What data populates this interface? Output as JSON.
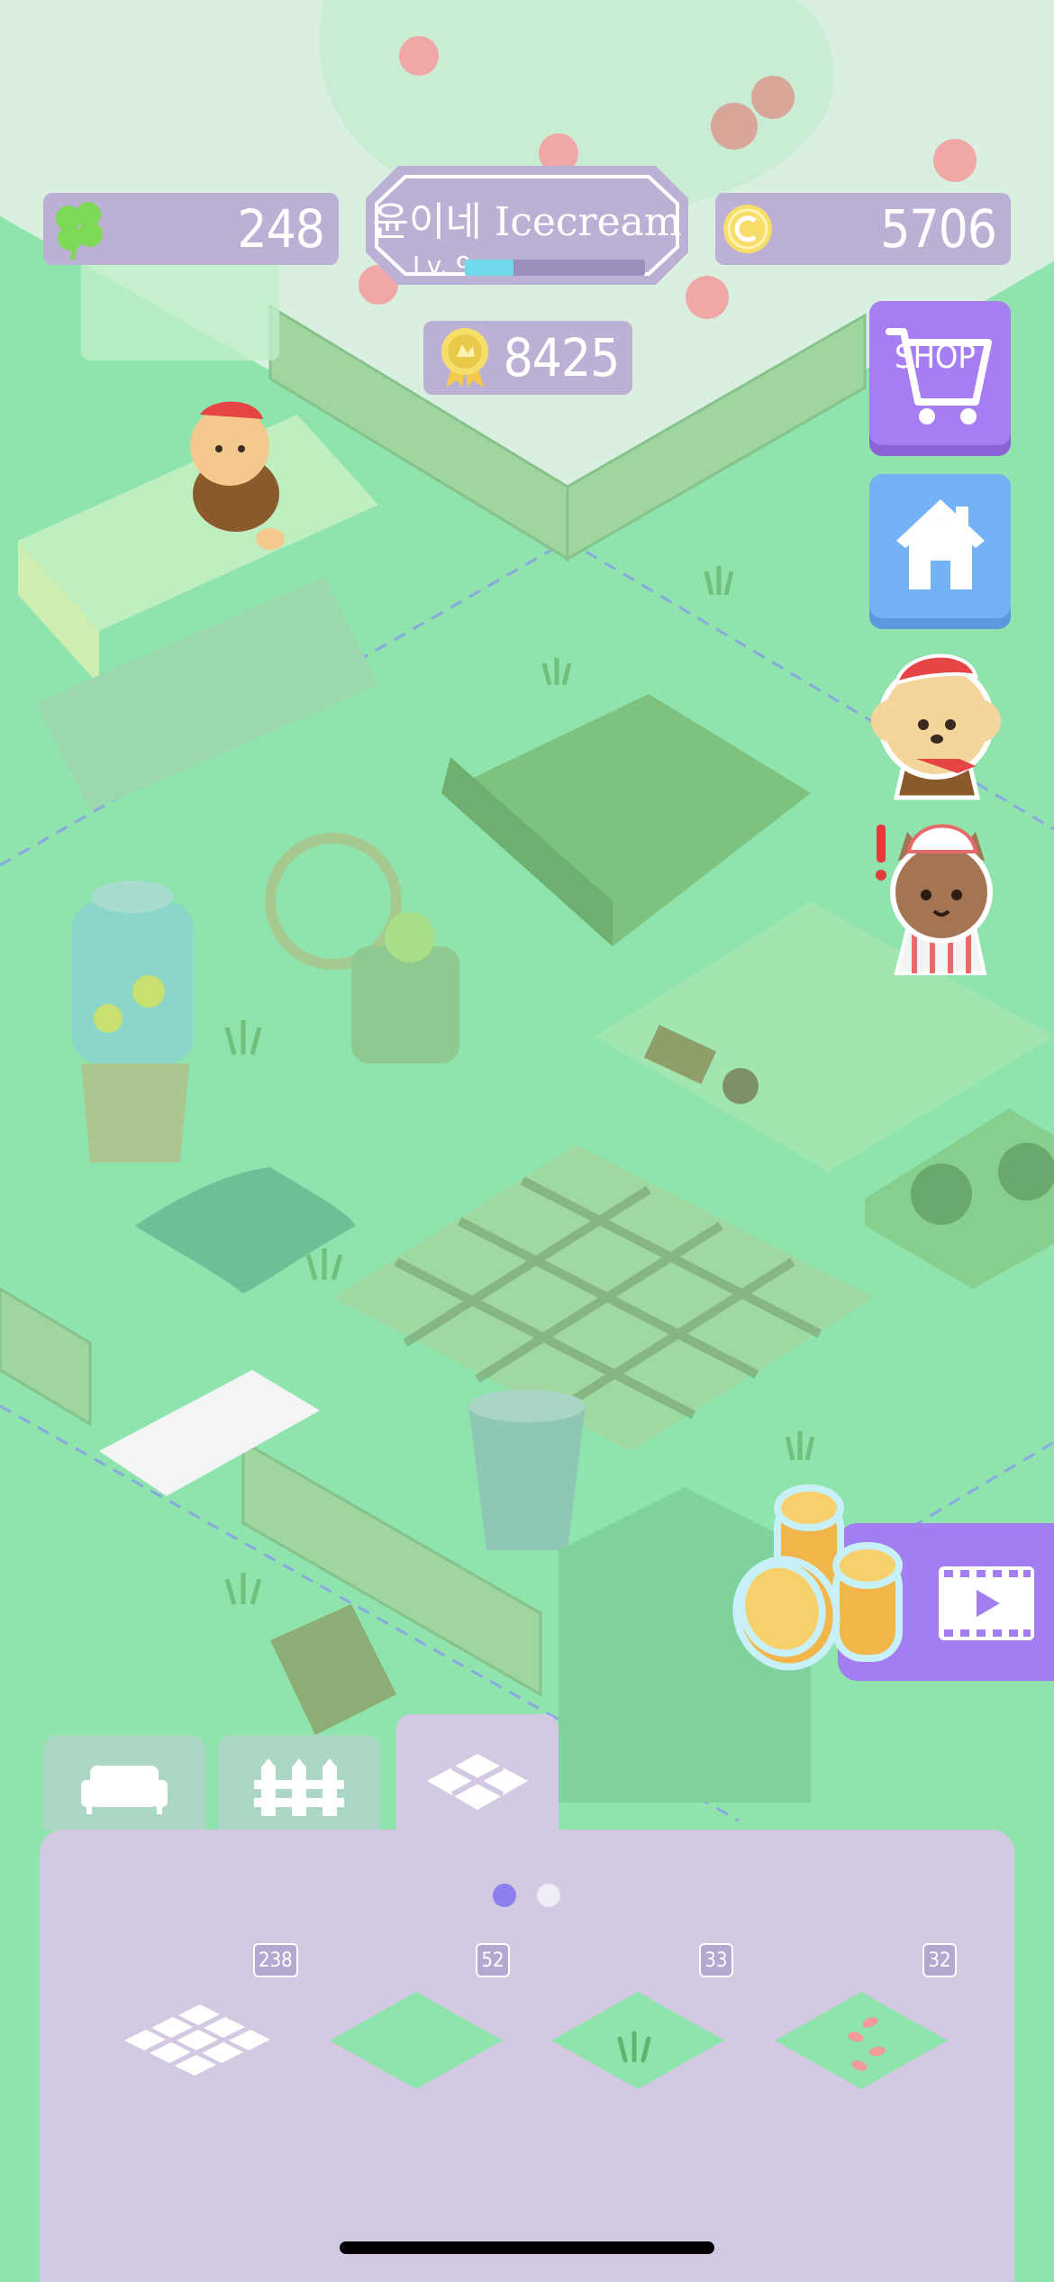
{
  "hud": {
    "clovers": "248",
    "coins": "5706",
    "trophy_points": "8425",
    "shop_name": "윤이네 Icecream",
    "level_label": "Lv. 9",
    "xp_progress": 0.27
  },
  "side_buttons": {
    "shop_label": "SHOP"
  },
  "build_panel": {
    "tabs": [
      {
        "name": "furniture",
        "selected": false
      },
      {
        "name": "fence",
        "selected": false
      },
      {
        "name": "floor",
        "selected": true
      }
    ],
    "page_indicator": {
      "pages": 2,
      "current": 1
    },
    "items": [
      {
        "icon": "white-brick-tile-icon",
        "count": "238"
      },
      {
        "icon": "grass-tile-icon",
        "count": "52"
      },
      {
        "icon": "grass-tuft-tile-icon",
        "count": "33"
      },
      {
        "icon": "petal-grass-tile-icon",
        "count": "32"
      }
    ]
  },
  "colors": {
    "ground": "#8fe3ad",
    "hud_pill": "#bcb0d4",
    "panel": "#d3c9e2",
    "shop_button": "#a67ef2",
    "home_button": "#74b1f5",
    "xp_fill": "#6fd9ea",
    "dot_active": "#8b7ff0"
  }
}
